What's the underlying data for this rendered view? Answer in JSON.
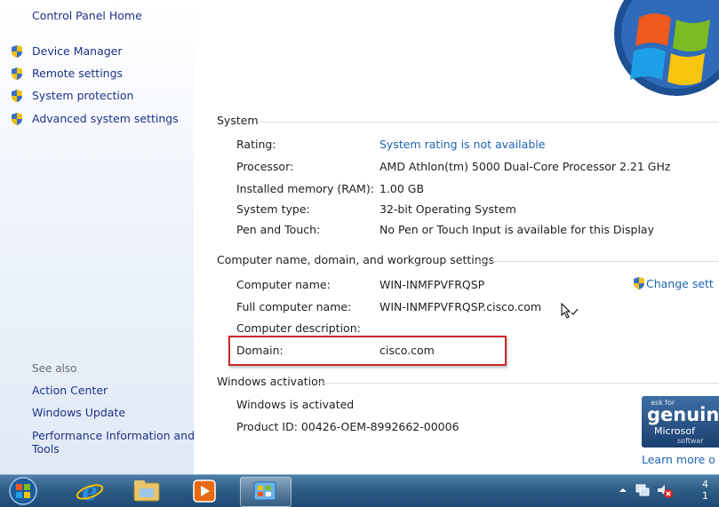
{
  "sidebar": {
    "home": "Control Panel Home",
    "tasks": [
      "Device Manager",
      "Remote settings",
      "System protection",
      "Advanced system settings"
    ],
    "see_also_heading": "See also",
    "see_also": [
      "Action Center",
      "Windows Update",
      "Performance Information and",
      "Tools"
    ]
  },
  "system": {
    "heading": "System",
    "rating_label": "Rating:",
    "rating_value": "System rating is not available",
    "processor_label": "Processor:",
    "processor_value": "AMD Athlon(tm) 5000 Dual-Core Processor  2.21 GHz",
    "memory_label": "Installed memory (RAM):",
    "memory_value": "1.00 GB",
    "type_label": "System type:",
    "type_value": "32-bit Operating System",
    "pen_label": "Pen and Touch:",
    "pen_value": "No Pen or Touch Input is available for this Display"
  },
  "computer": {
    "heading": "Computer name, domain, and workgroup settings",
    "name_label": "Computer name:",
    "name_value": "WIN-INMFPVFRQSP",
    "full_label": "Full computer name:",
    "full_value": "WIN-INMFPVFRQSP.cisco.com",
    "desc_label": "Computer description:",
    "domain_label": "Domain:",
    "domain_value": "cisco.com",
    "change_label": "Change sett"
  },
  "activation": {
    "heading": "Windows activation",
    "status": "Windows is activated",
    "product_id": "Product ID: 00426-OEM-8992662-00006",
    "badge_ask": "ask for",
    "badge_genuine": "genuin",
    "badge_ms": "Microsof",
    "badge_sw": "softwar",
    "learn_more": "Learn more o"
  },
  "taskbar": {
    "clock_line1": "4",
    "clock_line2": "1"
  },
  "colors": {
    "link": "#1e64b4",
    "highlight_box": "#c8282b",
    "taskbar": "#2e5d86"
  }
}
